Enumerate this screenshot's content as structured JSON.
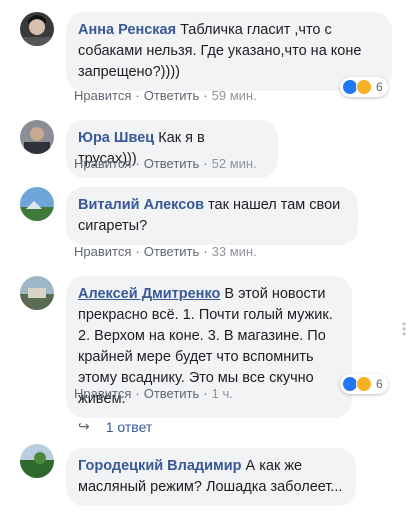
{
  "comments": [
    {
      "author": "Анна Ренская",
      "text": "Табличка гласит ,что с собаками нельзя. Где указано,что на коне запрещено?))))",
      "like": "Нравится",
      "reply": "Ответить",
      "time": "59 мин.",
      "reactions_count": "6"
    },
    {
      "author": "Юра Швец",
      "text": "Как я в трусах)))",
      "like": "Нравится",
      "reply": "Ответить",
      "time": "52 мин."
    },
    {
      "author": "Виталий Алексов",
      "text": "так нашел там свои сигареты?",
      "like": "Нравится",
      "reply": "Ответить",
      "time": "33 мин."
    },
    {
      "author": "Алексей Дмитренко",
      "text": "В этой новости прекрасно всё. 1. Почти голый мужик. 2. Верхом на коне. 3. В магазине. По крайней мере будет что вспомнить этому всаднику. Это мы все скучно живём.",
      "like": "Нравится",
      "reply": "Ответить",
      "time": "1 ч.",
      "reactions_count": "6",
      "replies_label": "1 ответ"
    },
    {
      "author": "Городецкий Владимир",
      "text": "А как же масляный режим? Лошадка заболеет..."
    }
  ],
  "icons": {
    "like": "like-reaction-icon",
    "haha": "haha-reaction-icon",
    "reply_arrow": "reply-arrow-icon"
  },
  "colors": {
    "author": "#385898",
    "bubble": "#f2f3f5",
    "meta": "#606770",
    "like_blue": "#2078f4",
    "haha_yellow": "#f7b125"
  }
}
